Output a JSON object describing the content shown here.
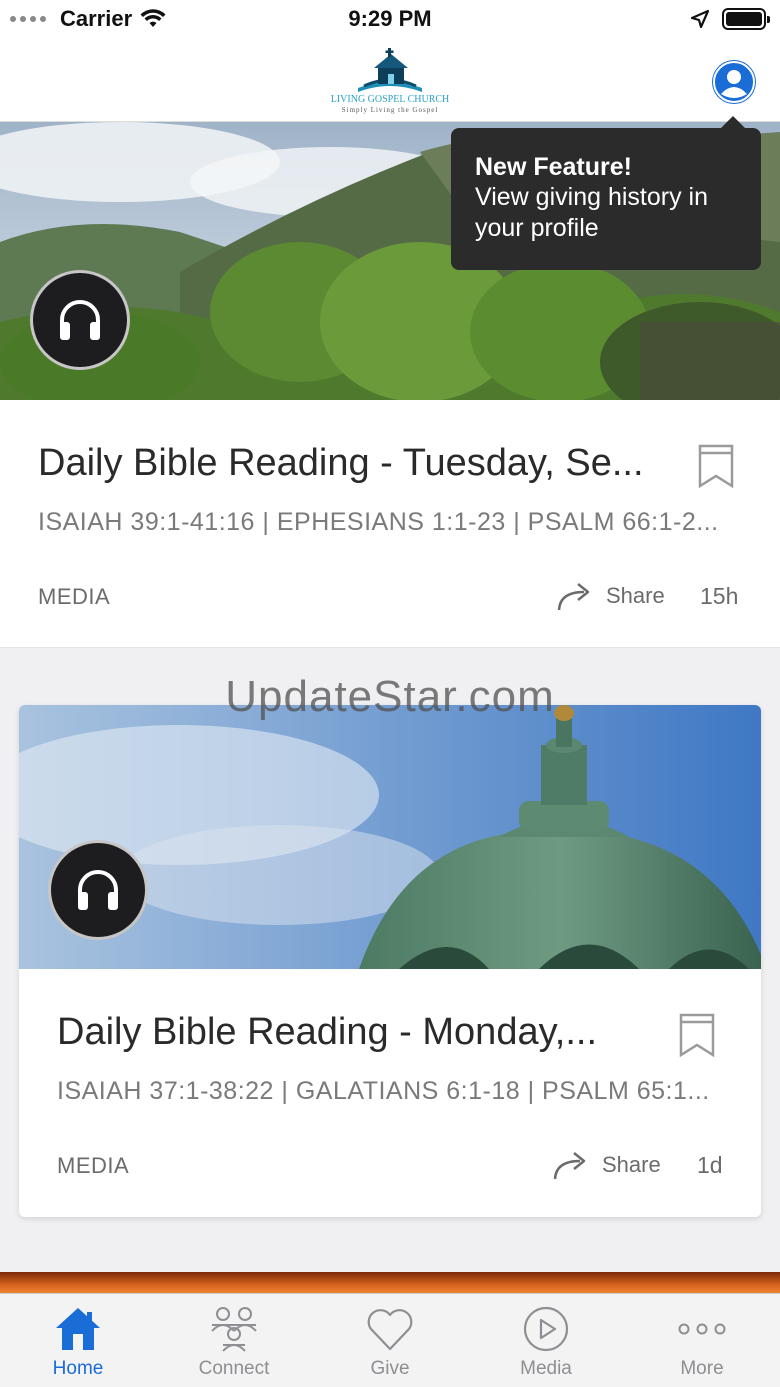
{
  "status_bar": {
    "carrier": "Carrier",
    "time": "9:29 PM"
  },
  "header": {
    "logo_title": "LIVING GOSPEL CHURCH",
    "logo_subtitle": "Simply Living the Gospel"
  },
  "tooltip": {
    "title": "New Feature!",
    "body": "View giving history in your profile"
  },
  "feed": [
    {
      "title": "Daily Bible Reading - Tuesday, Se...",
      "subtitle": "ISAIAH 39:1-41:16 | EPHESIANS 1:1-23 | PSALM 66:1-2...",
      "category": "MEDIA",
      "share_label": "Share",
      "age": "15h"
    },
    {
      "title": "Daily Bible Reading - Monday,...",
      "subtitle": "ISAIAH 37:1-38:22 | GALATIANS 6:1-18 | PSALM 65:1...",
      "category": "MEDIA",
      "share_label": "Share",
      "age": "1d"
    }
  ],
  "watermark": "UpdateStar.com",
  "tabs": [
    {
      "label": "Home",
      "icon": "home-icon",
      "active": true
    },
    {
      "label": "Connect",
      "icon": "people-icon",
      "active": false
    },
    {
      "label": "Give",
      "icon": "heart-icon",
      "active": false
    },
    {
      "label": "Media",
      "icon": "play-icon",
      "active": false
    },
    {
      "label": "More",
      "icon": "more-icon",
      "active": false
    }
  ],
  "colors": {
    "accent": "#1a6cd6",
    "tooltip_bg": "#2b2b2b",
    "badge_bg": "#1d1d1f"
  }
}
